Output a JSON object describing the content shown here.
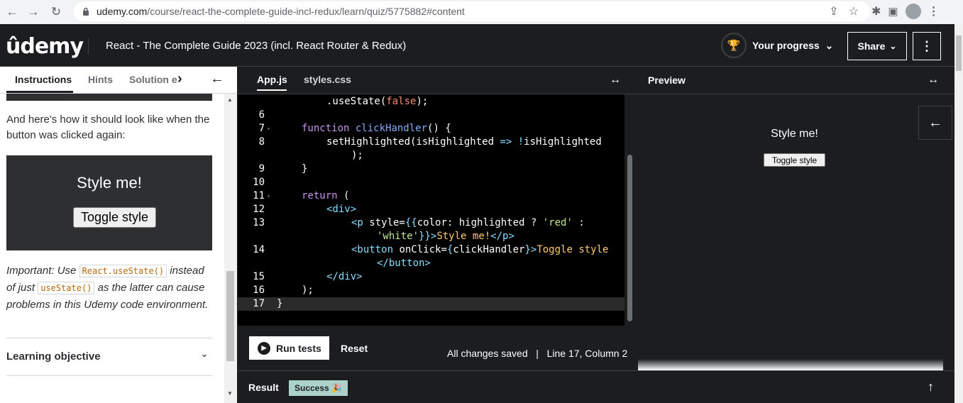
{
  "browser": {
    "url_host": "udemy.com",
    "url_path": "/course/react-the-complete-guide-incl-redux/learn/quiz/5775882#content"
  },
  "header": {
    "logo": "ûdemy",
    "course_title": "React - The Complete Guide 2023 (incl. React Router & Redux)",
    "progress_label": "Your progress",
    "share_label": "Share"
  },
  "left": {
    "tabs": [
      "Instructions",
      "Hints",
      "Solution e"
    ],
    "paragraph": "And here's how it should look like when the button was clicked again:",
    "demo_text": "Style me!",
    "demo_button": "Toggle style",
    "important_1": "Important: Use ",
    "important_code1": "React.useState()",
    "important_2": " instead of just ",
    "important_code2": "useState()",
    "important_3": " as the latter can cause problems in this Udemy code environment.",
    "learning_objective": "Learning objective"
  },
  "editor": {
    "tabs": [
      "App.js",
      "styles.css"
    ],
    "run_tests": "Run tests",
    "reset": "Reset",
    "status": "All changes saved   |   Line 17, Column 2"
  },
  "preview": {
    "title": "Preview",
    "text": "Style me!",
    "button": "Toggle style"
  },
  "result": {
    "label": "Result",
    "badge": "Success 🎉"
  },
  "colors": {
    "accent": "#a435f0",
    "success": "#acd2cc"
  }
}
